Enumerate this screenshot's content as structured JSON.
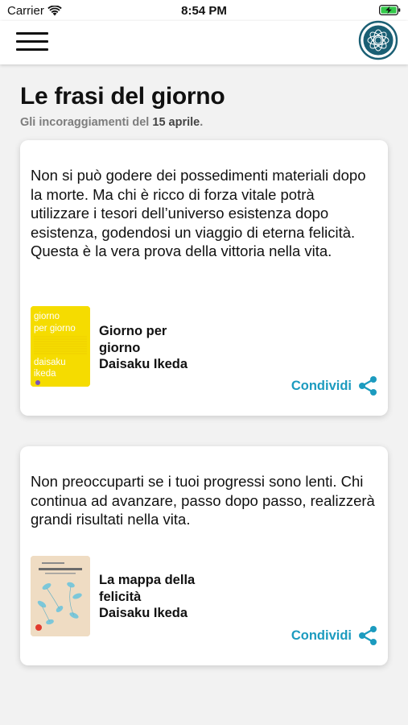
{
  "status_bar": {
    "carrier": "Carrier",
    "time": "8:54 PM",
    "icons": [
      "wifi-icon",
      "battery-charging-icon"
    ]
  },
  "nav": {
    "menu_icon": "hamburger-menu-icon",
    "logo_icon": "lotus-logo-icon"
  },
  "page": {
    "title": "Le frasi del giorno",
    "subtitle_prefix": "Gli incoraggiamenti del ",
    "subtitle_date": "15 aprile",
    "subtitle_suffix": "."
  },
  "quotes": [
    {
      "text": "Non si può godere dei possedimenti materiali dopo la morte. Ma chi è ricco di forza vitale potrà utilizzare i tesori dell’universo esistenza dopo esistenza, godendosi un viaggio di eterna felicità. Questa è la vera prova della vittoria nella vita.",
      "book": {
        "title_line1": "Giorno per",
        "title_line2": "giorno",
        "author": "Daisaku Ikeda",
        "cover_title_line1": "giorno",
        "cover_title_line2": "per giorno",
        "cover_author_line1": "daisaku",
        "cover_author_line2": "ikeda",
        "cover_color": "#f5dc00"
      },
      "share_label": "Condividi"
    },
    {
      "text": "Non preoccuparti se i tuoi progressi sono lenti. Chi continua ad avanzare, passo dopo passo, realizzerà grandi risultati nella vita.",
      "book": {
        "title_line1": "La mappa della",
        "title_line2": "felicità",
        "author": "Daisaku Ikeda",
        "cover_color": "#efdcc3"
      },
      "share_label": "Condividi"
    }
  ],
  "colors": {
    "accent": "#1c9bbf",
    "logo": "#1a5f74",
    "background": "#f2f2f2",
    "card": "#ffffff"
  }
}
